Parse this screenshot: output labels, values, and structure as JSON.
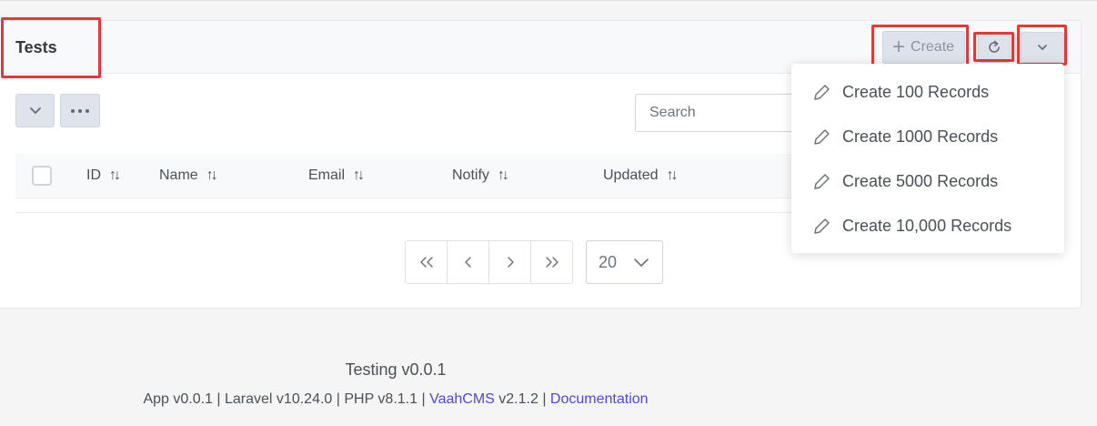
{
  "header": {
    "title": "Tests",
    "create_label": "Create"
  },
  "toolbar": {
    "search_placeholder": "Search"
  },
  "table": {
    "columns": [
      "ID",
      "Name",
      "Email",
      "Notify",
      "Updated"
    ]
  },
  "pagination": {
    "rows_per_page": "20"
  },
  "dropdown": {
    "items": [
      "Create 100 Records",
      "Create 1000 Records",
      "Create 5000 Records",
      "Create 10,000 Records"
    ]
  },
  "footer": {
    "title": "Testing v0.0.1",
    "app_version": "App v0.0.1",
    "laravel_version": "Laravel v10.24.0",
    "php_version": "PHP v8.1.1",
    "vaahcms_link": "VaahCMS",
    "vaahcms_version": "v2.1.2",
    "documentation_link": "Documentation"
  },
  "colors": {
    "highlight": "#e03a3a",
    "link": "#4f46e5"
  },
  "icons": [
    "plus-icon",
    "refresh-icon",
    "chevron-down-icon",
    "ellipsis-icon",
    "sort-icon",
    "pencil-icon",
    "first-page-icon",
    "prev-page-icon",
    "next-page-icon",
    "last-page-icon"
  ]
}
